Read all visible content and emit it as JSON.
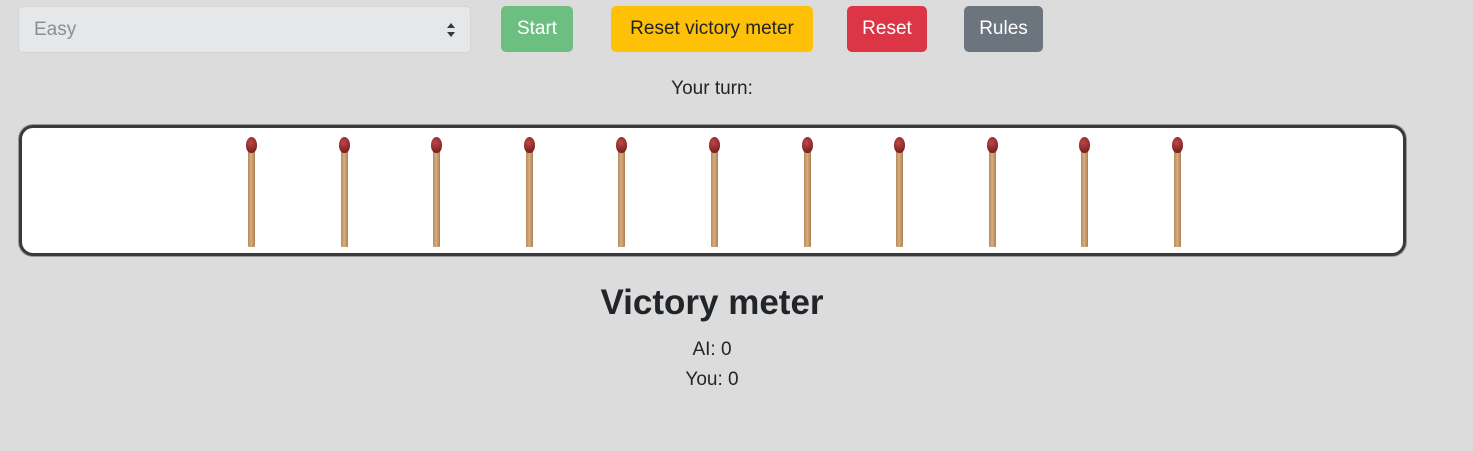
{
  "controls": {
    "difficulty_selected": "Easy",
    "start_label": "Start",
    "reset_meter_label": "Reset victory meter",
    "reset_label": "Reset",
    "rules_label": "Rules"
  },
  "game": {
    "turn_label": "Your turn:",
    "matches_remaining": 11
  },
  "victory_meter": {
    "title": "Victory meter",
    "ai_text": "AI: 0",
    "you_text": "You: 0"
  }
}
